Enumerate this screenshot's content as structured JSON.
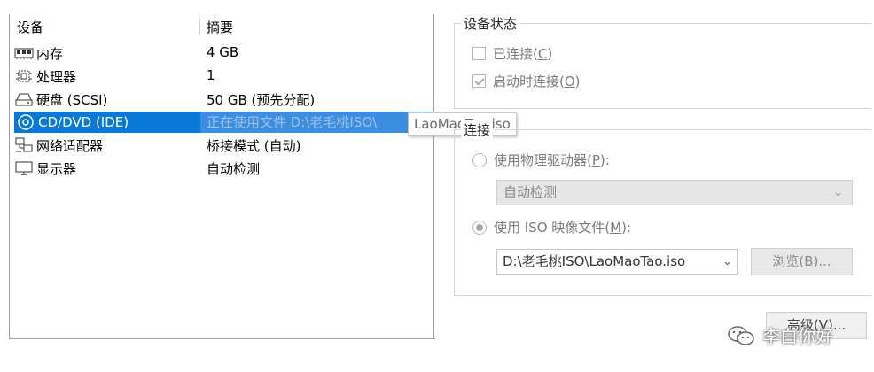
{
  "columns": {
    "device": "设备",
    "summary": "摘要"
  },
  "devices": [
    {
      "name": "内存",
      "summary": "4 GB",
      "icon": "memory-icon"
    },
    {
      "name": "处理器",
      "summary": "1",
      "icon": "cpu-icon"
    },
    {
      "name": "硬盘 (SCSI)",
      "summary": "50 GB (预先分配)",
      "icon": "harddisk-icon"
    },
    {
      "name": "CD/DVD (IDE)",
      "summary": "正在使用文件 D:\\老毛桃ISO\\",
      "icon": "cd-dvd-icon",
      "selected": true
    },
    {
      "name": "网络适配器",
      "summary": "桥接模式 (自动)",
      "icon": "network-adapter-icon"
    },
    {
      "name": "显示器",
      "summary": "自动检测",
      "icon": "display-icon"
    }
  ],
  "tooltip": "LaoMaoTao.iso",
  "device_status": {
    "title": "设备状态",
    "connected": {
      "label": "已连接(",
      "key": "C",
      "suffix": ")",
      "checked": false
    },
    "connect_on_power_on": {
      "label": "启动时连接(",
      "key": "O",
      "suffix": ")",
      "checked": true
    }
  },
  "connection": {
    "title": "连接",
    "physical_drive": {
      "label": "使用物理驱动器(",
      "key": "P",
      "suffix": "):",
      "selected": false
    },
    "physical_drive_value": "自动检测",
    "iso_image": {
      "label": "使用 ISO 映像文件(",
      "key": "M",
      "suffix": "):",
      "selected": true
    },
    "iso_path": "D:\\老毛桃ISO\\LaoMaoTao.iso",
    "browse": {
      "label": "浏览(",
      "key": "B",
      "suffix": ")..."
    }
  },
  "advanced_button": "高级(V)...",
  "watermark": "李白你好",
  "colors": {
    "selection": "#0a78d7",
    "disabled_text": "#7a7a7a"
  }
}
